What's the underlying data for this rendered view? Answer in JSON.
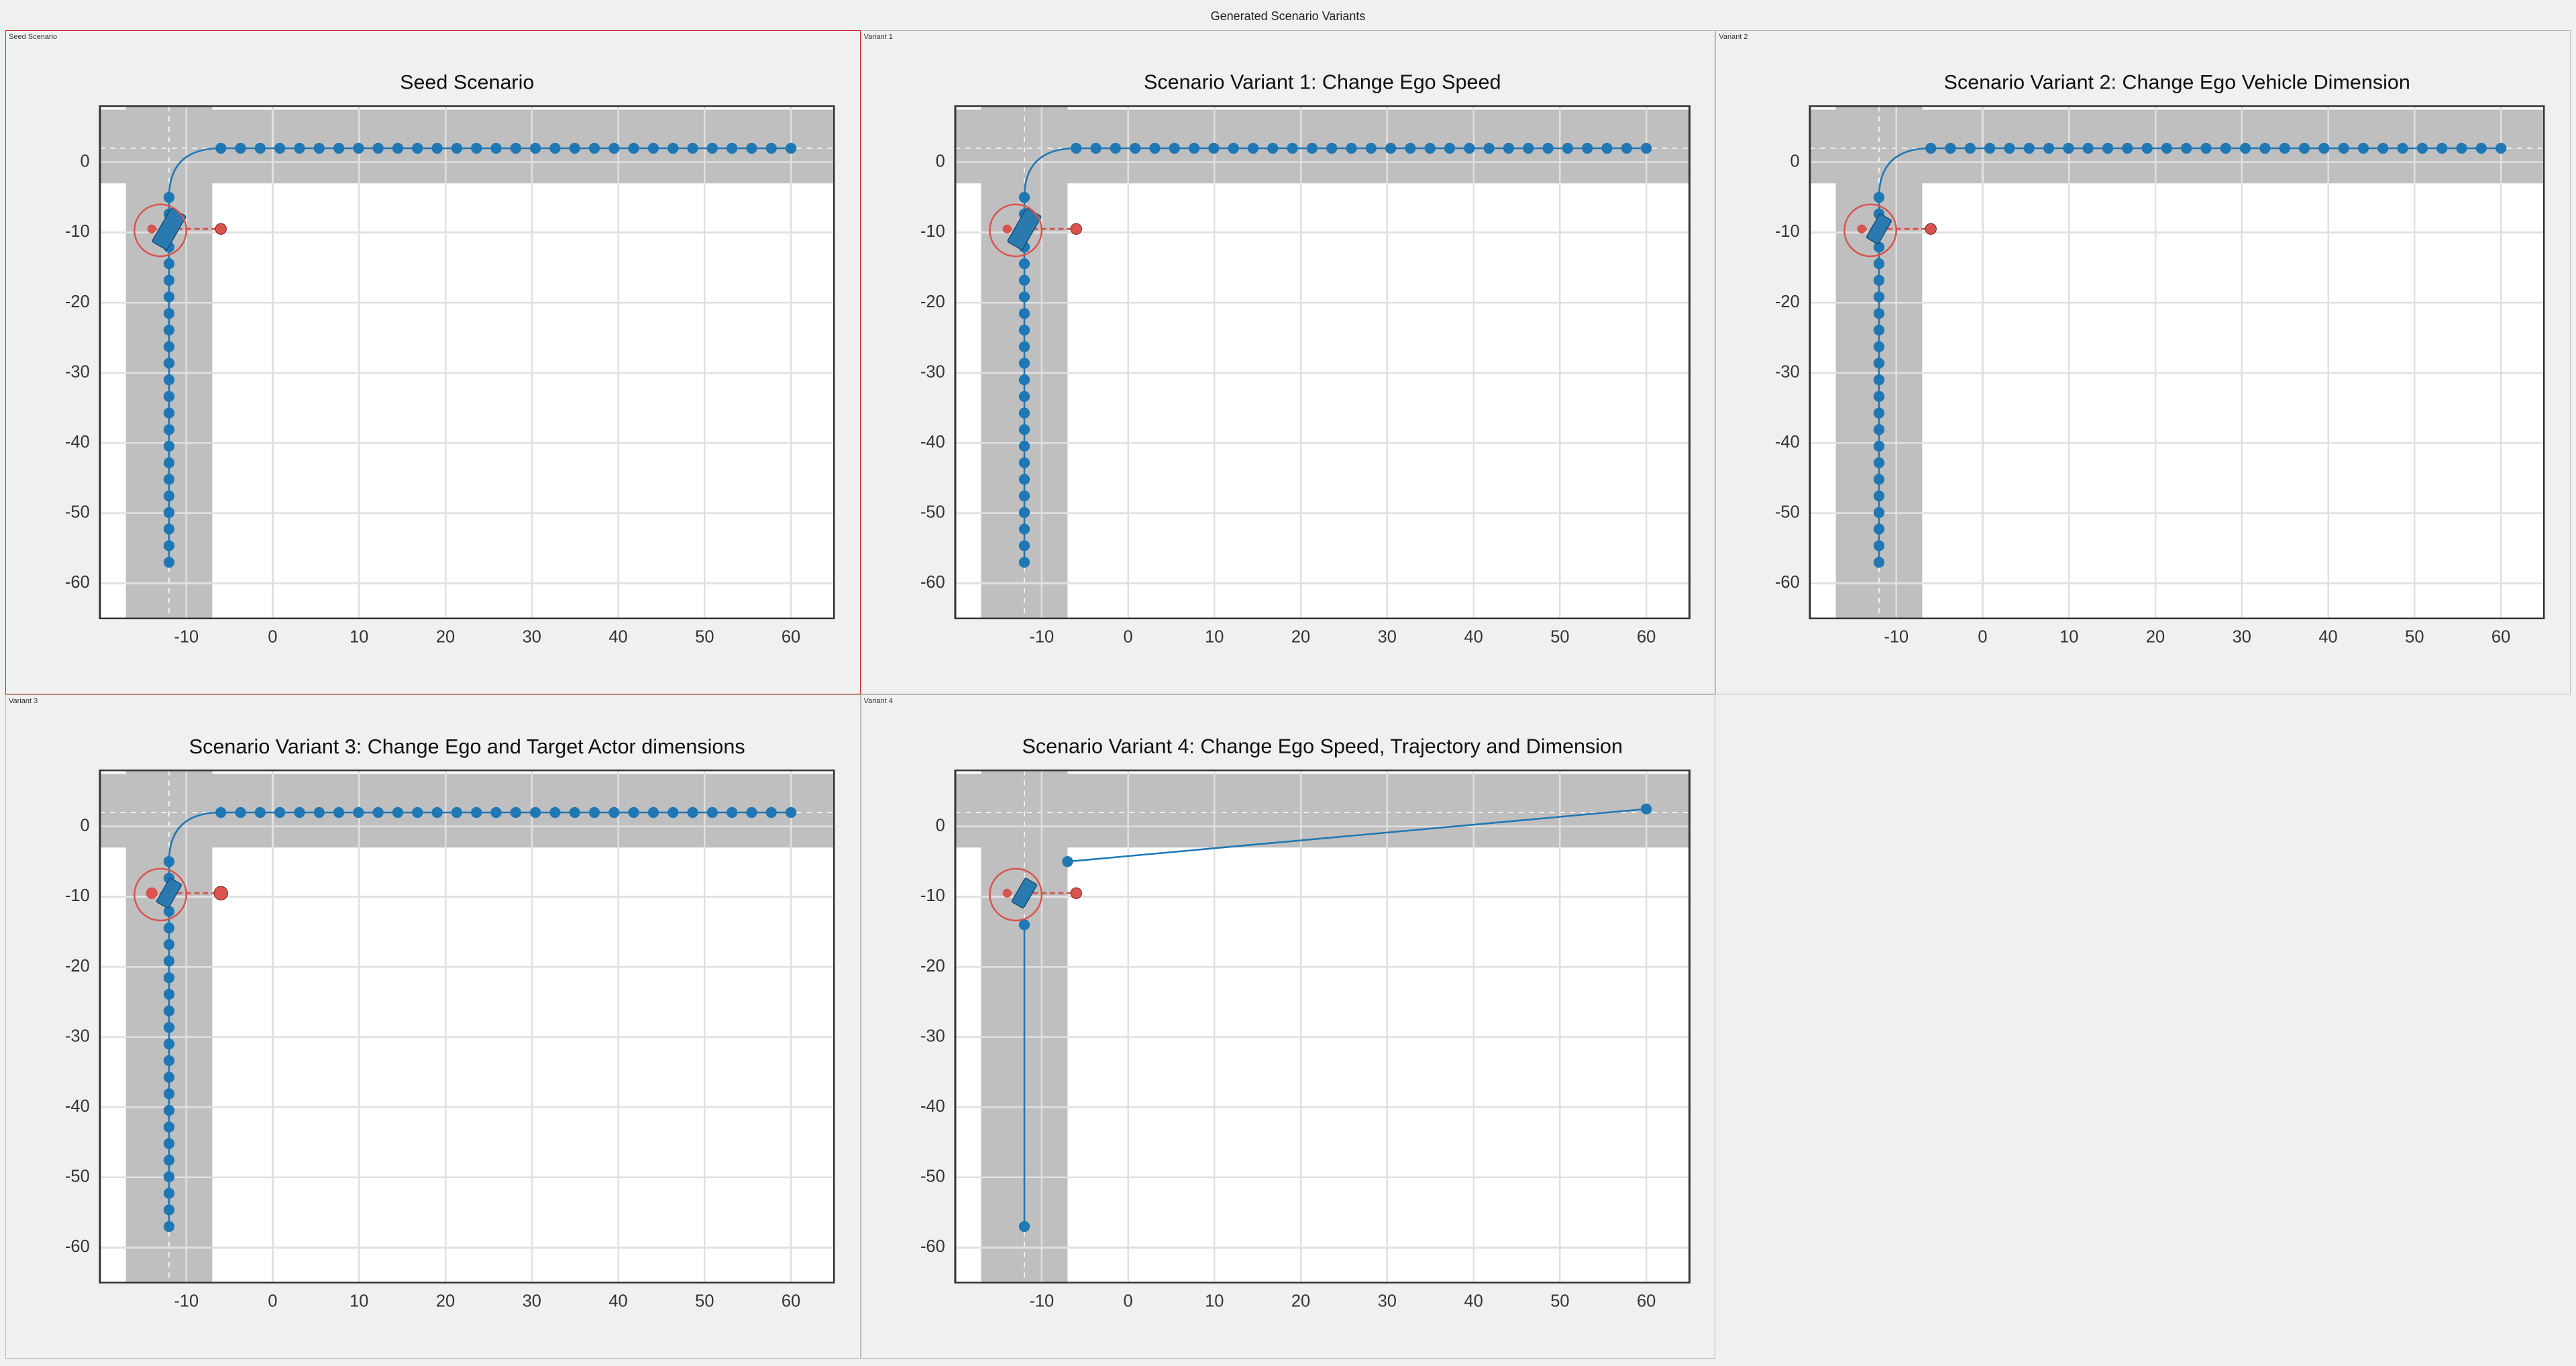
{
  "figure_title": "Generated Scenario Variants",
  "xticks": [
    -10,
    0,
    10,
    20,
    30,
    40,
    50,
    60
  ],
  "yticks": [
    0,
    -10,
    -20,
    -30,
    -40,
    -50,
    -60
  ],
  "xrange": [
    -20,
    65
  ],
  "yrange": [
    -65,
    8
  ],
  "panels": [
    {
      "label": "Seed Scenario",
      "title": "Seed Scenario",
      "selected": true,
      "variant": "seed"
    },
    {
      "label": "Variant 1",
      "title": "Scenario Variant 1: Change Ego Speed",
      "selected": false,
      "variant": "v1"
    },
    {
      "label": "Variant 2",
      "title": "Scenario Variant 2: Change Ego Vehicle Dimension",
      "selected": false,
      "variant": "v2"
    },
    {
      "label": "Variant 3",
      "title": "Scenario Variant 3: Change Ego and Target Actor dimensions",
      "selected": false,
      "variant": "v3"
    },
    {
      "label": "Variant 4",
      "title": "Scenario Variant 4: Change Ego Speed, Trajectory and Dimension",
      "selected": false,
      "variant": "v4"
    },
    null
  ],
  "chart_data": [
    {
      "id": "seed",
      "type": "scatter",
      "title": "Seed Scenario",
      "xrange": [
        -20,
        65
      ],
      "yrange": [
        -65,
        8
      ],
      "xticks": [
        -10,
        0,
        10,
        20,
        30,
        40,
        50,
        60
      ],
      "yticks": [
        0,
        -10,
        -20,
        -30,
        -40,
        -50,
        -60
      ],
      "series": [
        {
          "name": "Ego trajectory horizontal",
          "style": "ego",
          "mode": "line",
          "x_start": -6,
          "x_end": 60,
          "y": 2,
          "n": 30
        },
        {
          "name": "Ego trajectory vertical",
          "style": "ego",
          "mode": "line",
          "x": -12,
          "y_start": -57,
          "y_end": -5,
          "n": 23
        },
        {
          "name": "Target (pedestrian) path",
          "style": "target",
          "y": -9.5,
          "x_start": -14,
          "x_end": -6,
          "n": 2
        }
      ],
      "ego_vehicle": {
        "x": -12,
        "y": -9.5,
        "w": 4.5,
        "h": 2,
        "rotation_deg": 60
      },
      "collision_marker": {
        "x": -13,
        "y": -9.7,
        "r": 3
      }
    },
    {
      "id": "v1",
      "type": "scatter",
      "title": "Scenario Variant 1: Change Ego Speed",
      "inherits": "seed",
      "ego_vehicle": {
        "x": -12,
        "y": -9.5,
        "w": 4.5,
        "h": 2,
        "rotation_deg": 60
      }
    },
    {
      "id": "v2",
      "type": "scatter",
      "title": "Scenario Variant 2: Change Ego Vehicle Dimension",
      "inherits": "seed",
      "ego_vehicle": {
        "x": -12,
        "y": -9.5,
        "w": 3.2,
        "h": 1.6,
        "rotation_deg": 60
      }
    },
    {
      "id": "v3",
      "type": "scatter",
      "title": "Scenario Variant 3: Change Ego and Target Actor dimensions",
      "inherits": "seed",
      "ego_vehicle": {
        "x": -12,
        "y": -9.5,
        "w": 3.2,
        "h": 1.6,
        "rotation_deg": 60
      },
      "target_override": {
        "y": -9.5,
        "x_start": -14,
        "x_end": -6,
        "n": 2,
        "larger": true
      }
    },
    {
      "id": "v4",
      "type": "scatter",
      "title": "Scenario Variant 4: Change Ego Speed, Trajectory and Dimension",
      "xrange": [
        -20,
        65
      ],
      "yrange": [
        -65,
        8
      ],
      "series": [
        {
          "name": "Ego trajectory horizontal",
          "style": "ego",
          "mode": "sparse",
          "points": [
            [
              -7,
              -5
            ],
            [
              60,
              2.5
            ]
          ]
        },
        {
          "name": "Ego trajectory vertical",
          "style": "ego",
          "mode": "sparse",
          "points": [
            [
              -12,
              -57
            ],
            [
              -12,
              -14
            ]
          ]
        },
        {
          "name": "Target (pedestrian) path",
          "style": "target",
          "y": -9.5,
          "x_start": -14,
          "x_end": -6,
          "n": 2
        }
      ],
      "ego_vehicle": {
        "x": -12,
        "y": -9.5,
        "w": 3.2,
        "h": 1.6,
        "rotation_deg": 60
      },
      "collision_marker": {
        "x": -13,
        "y": -9.7,
        "r": 3
      }
    }
  ]
}
